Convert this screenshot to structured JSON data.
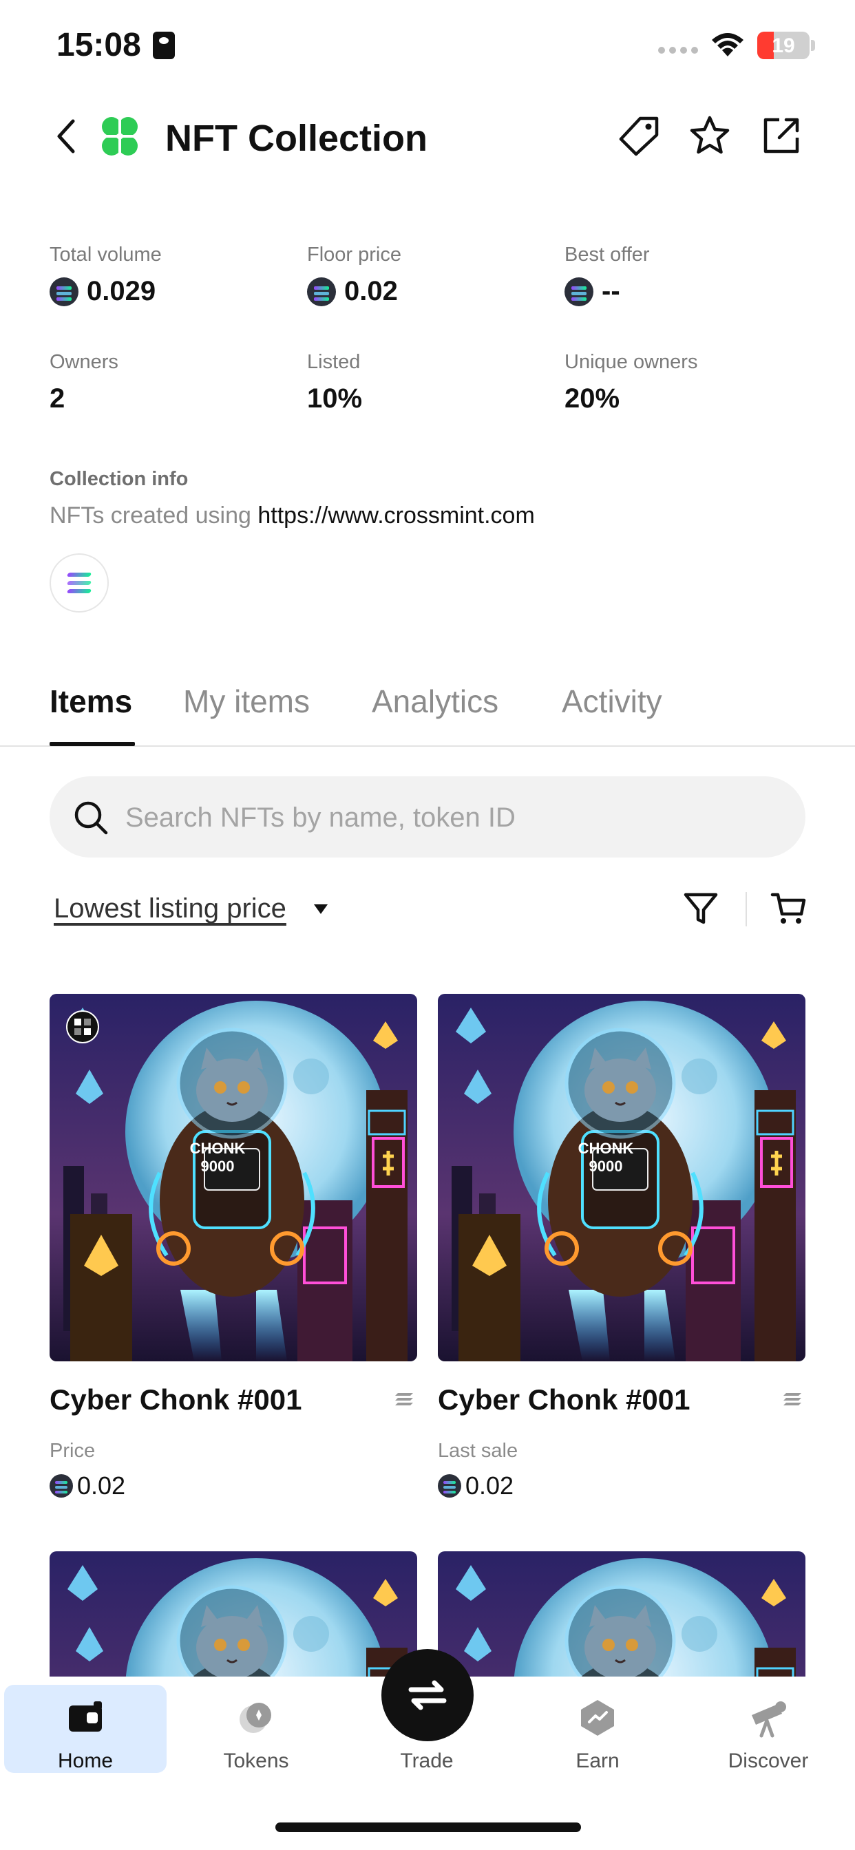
{
  "status_bar": {
    "time": "15:08",
    "battery": "19"
  },
  "header": {
    "title": "NFT Collection"
  },
  "stats": [
    {
      "label": "Total volume",
      "value": "0.029",
      "sol": true
    },
    {
      "label": "Floor price",
      "value": "0.02",
      "sol": true
    },
    {
      "label": "Best offer",
      "value": "--",
      "sol": true
    },
    {
      "label": "Owners",
      "value": "2",
      "sol": false
    },
    {
      "label": "Listed",
      "value": "10%",
      "sol": false
    },
    {
      "label": "Unique owners",
      "value": "20%",
      "sol": false
    }
  ],
  "collection_info": {
    "title": "Collection info",
    "prefix": "NFTs created using ",
    "link": "https://www.crossmint.com"
  },
  "tabs": [
    {
      "label": "Items",
      "active": true
    },
    {
      "label": "My items",
      "active": false
    },
    {
      "label": "Analytics",
      "active": false
    },
    {
      "label": "Activity",
      "active": false
    }
  ],
  "search": {
    "placeholder": "Search NFTs by name, token ID",
    "value": ""
  },
  "sort": {
    "label": "Lowest listing price"
  },
  "items": [
    {
      "name": "Cyber Chonk #001",
      "sub_label": "Price",
      "price": "0.02",
      "image_text": "CHONK 9000"
    },
    {
      "name": "Cyber Chonk #001",
      "sub_label": "Last sale",
      "price": "0.02",
      "image_text": "CHONK 9000"
    },
    {
      "name": "",
      "sub_label": "",
      "price": "",
      "image_text": ""
    },
    {
      "name": "",
      "sub_label": "",
      "price": "",
      "image_text": ""
    }
  ],
  "bottom_nav": [
    {
      "label": "Home",
      "active": true
    },
    {
      "label": "Tokens",
      "active": false
    },
    {
      "label": "Trade",
      "active": false
    },
    {
      "label": "Earn",
      "active": false
    },
    {
      "label": "Discover",
      "active": false
    }
  ],
  "colors": {
    "accent_active_bg": "#dcebff",
    "text": "#111111",
    "muted": "#8a8a8a"
  }
}
